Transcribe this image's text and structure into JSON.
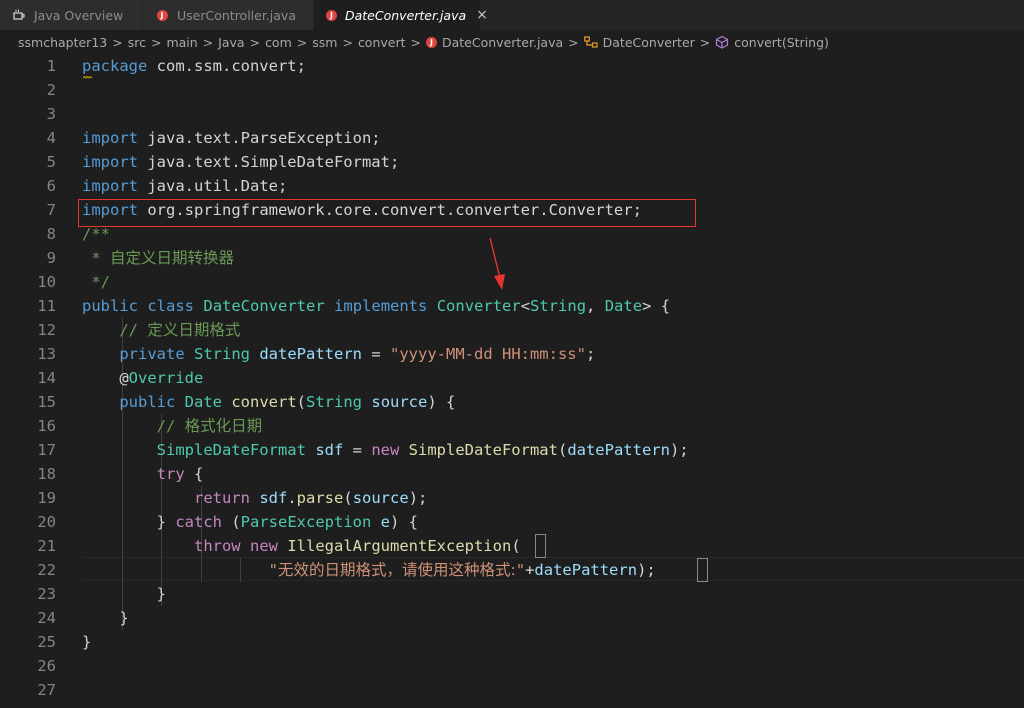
{
  "tabs": [
    {
      "label": "Java Overview",
      "icon": "java-overview-icon"
    },
    {
      "label": "UserController.java",
      "icon": "java-file-icon"
    },
    {
      "label": "DateConverter.java",
      "icon": "java-file-icon",
      "active": true,
      "close": "×"
    }
  ],
  "breadcrumb": {
    "items": [
      "ssmchapter13",
      "src",
      "main",
      "Java",
      "com",
      "ssm",
      "convert",
      "DateConverter.java",
      "DateConverter",
      "convert(String)"
    ],
    "separator": ">"
  },
  "editor": {
    "line_numbers": [
      "1",
      "2",
      "3",
      "4",
      "5",
      "6",
      "7",
      "8",
      "9",
      "10",
      "11",
      "12",
      "13",
      "14",
      "15",
      "16",
      "17",
      "18",
      "19",
      "20",
      "21",
      "22",
      "23",
      "24",
      "25",
      "26",
      "27"
    ],
    "lines": [
      [
        [
          "kw",
          "package"
        ],
        [
          "t",
          " com.ssm.convert;"
        ]
      ],
      [],
      [],
      [
        [
          "kw",
          "import"
        ],
        [
          "t",
          " java.text.ParseException;"
        ]
      ],
      [
        [
          "kw",
          "import"
        ],
        [
          "t",
          " java.text.SimpleDateFormat;"
        ]
      ],
      [
        [
          "kw",
          "import"
        ],
        [
          "t",
          " java.util.Date;"
        ]
      ],
      [
        [
          "kw",
          "import"
        ],
        [
          "t",
          " org.springframework.core.convert.converter.Converter;"
        ]
      ],
      [
        [
          "cm",
          "/**"
        ]
      ],
      [
        [
          "cm",
          " * "
        ],
        [
          "cm cjk",
          "自定义日期转换器"
        ]
      ],
      [
        [
          "cm",
          " */"
        ]
      ],
      [
        [
          "kw",
          "public"
        ],
        [
          "t",
          " "
        ],
        [
          "kw",
          "class"
        ],
        [
          "t",
          " "
        ],
        [
          "ty",
          "DateConverter"
        ],
        [
          "t",
          " "
        ],
        [
          "kw",
          "implements"
        ],
        [
          "t",
          " "
        ],
        [
          "ty",
          "Converter"
        ],
        [
          "t",
          "<"
        ],
        [
          "ty",
          "String"
        ],
        [
          "t",
          ", "
        ],
        [
          "ty",
          "Date"
        ],
        [
          "t",
          "> {"
        ]
      ],
      [
        [
          "t",
          "    "
        ],
        [
          "cm",
          "// "
        ],
        [
          "cm cjk",
          "定义日期格式"
        ]
      ],
      [
        [
          "t",
          "    "
        ],
        [
          "kw",
          "private"
        ],
        [
          "t",
          " "
        ],
        [
          "ty",
          "String"
        ],
        [
          "t",
          " "
        ],
        [
          "var",
          "datePattern"
        ],
        [
          "t",
          " = "
        ],
        [
          "str",
          "\"yyyy-MM-dd HH:mm:ss\""
        ],
        [
          "t",
          ";"
        ]
      ],
      [
        [
          "t",
          "    @"
        ],
        [
          "ty",
          "Override"
        ]
      ],
      [
        [
          "t",
          "    "
        ],
        [
          "kw",
          "public"
        ],
        [
          "t",
          " "
        ],
        [
          "ty",
          "Date"
        ],
        [
          "t",
          " "
        ],
        [
          "fn",
          "convert"
        ],
        [
          "t",
          "("
        ],
        [
          "ty",
          "String"
        ],
        [
          "t",
          " "
        ],
        [
          "var",
          "source"
        ],
        [
          "t",
          ") {"
        ]
      ],
      [
        [
          "t",
          "        "
        ],
        [
          "cm",
          "// "
        ],
        [
          "cm cjk",
          "格式化日期"
        ]
      ],
      [
        [
          "t",
          "        "
        ],
        [
          "ty",
          "SimpleDateFormat"
        ],
        [
          "t",
          " "
        ],
        [
          "var",
          "sdf"
        ],
        [
          "t",
          " = "
        ],
        [
          "ctl",
          "new"
        ],
        [
          "t",
          " "
        ],
        [
          "fn",
          "SimpleDateFormat"
        ],
        [
          "t",
          "("
        ],
        [
          "var",
          "datePattern"
        ],
        [
          "t",
          ");"
        ]
      ],
      [
        [
          "t",
          "        "
        ],
        [
          "ctl",
          "try"
        ],
        [
          "t",
          " {"
        ]
      ],
      [
        [
          "t",
          "            "
        ],
        [
          "ctl",
          "return"
        ],
        [
          "t",
          " "
        ],
        [
          "var",
          "sdf"
        ],
        [
          "t",
          "."
        ],
        [
          "fn",
          "parse"
        ],
        [
          "t",
          "("
        ],
        [
          "var",
          "source"
        ],
        [
          "t",
          ");"
        ]
      ],
      [
        [
          "t",
          "        } "
        ],
        [
          "ctl",
          "catch"
        ],
        [
          "t",
          " ("
        ],
        [
          "ty",
          "ParseException"
        ],
        [
          "t",
          " "
        ],
        [
          "var",
          "e"
        ],
        [
          "t",
          ") {"
        ]
      ],
      [
        [
          "t",
          "            "
        ],
        [
          "ctl",
          "throw"
        ],
        [
          "t",
          " "
        ],
        [
          "ctl",
          "new"
        ],
        [
          "t",
          " "
        ],
        [
          "fn",
          "IllegalArgumentException"
        ],
        [
          "t",
          "("
        ]
      ],
      [
        [
          "t",
          "                    "
        ],
        [
          "str",
          "\""
        ],
        [
          "str cjk",
          "无效的日期格式，请使用这种格式:"
        ],
        [
          "str",
          "\""
        ],
        [
          "t",
          "+"
        ],
        [
          "var",
          "datePattern"
        ],
        [
          "t",
          ");"
        ]
      ],
      [
        [
          "t",
          "        }"
        ]
      ],
      [
        [
          "t",
          "    }"
        ]
      ],
      [
        [
          "t",
          "}"
        ]
      ],
      [],
      []
    ]
  },
  "colors": {
    "background": "#1e1e1e",
    "keyword": "#569cd6",
    "control": "#c586c0",
    "type": "#4ec9b0",
    "function": "#dcdcaa",
    "variable": "#9cdcfe",
    "string": "#ce9178",
    "comment": "#6a9955",
    "annotation_red": "#e8342d"
  }
}
